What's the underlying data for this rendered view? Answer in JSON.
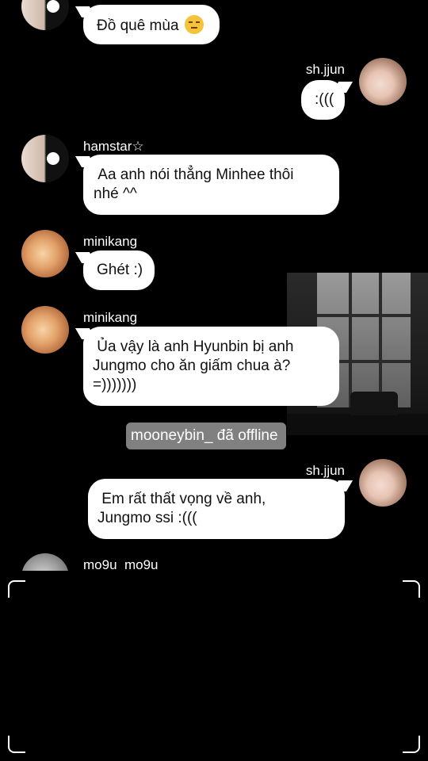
{
  "messages": [
    {
      "sender": "",
      "text": "Đồ quê mùa",
      "emoji": "unamused-face-emoji",
      "side": "left"
    },
    {
      "sender": "sh.jjun",
      "text": ":(((",
      "side": "right"
    },
    {
      "sender": "hamstar☆",
      "text": " Aa anh nói thẳng Minhee thôi\nnhé ^^",
      "side": "left"
    },
    {
      "sender": "minikang",
      "text": "Ghét :)",
      "side": "left"
    },
    {
      "sender": "minikang",
      "text": " Ủa vậy là anh Hyunbin bị anh\nJungmo cho ăn giấm chua à?\n=)))))))",
      "side": "left"
    },
    {
      "sender": "sh.jjun",
      "text": " Em rất thất vọng về anh,\nJungmo ssi :(((",
      "side": "right"
    },
    {
      "sender": "mo9u_mo9u",
      "text": "",
      "side": "left"
    }
  ],
  "system_notice": "mooneybin_ đã offline",
  "colors": {
    "background": "#000000",
    "bubble": "#ffffff",
    "notice": "#969696"
  }
}
